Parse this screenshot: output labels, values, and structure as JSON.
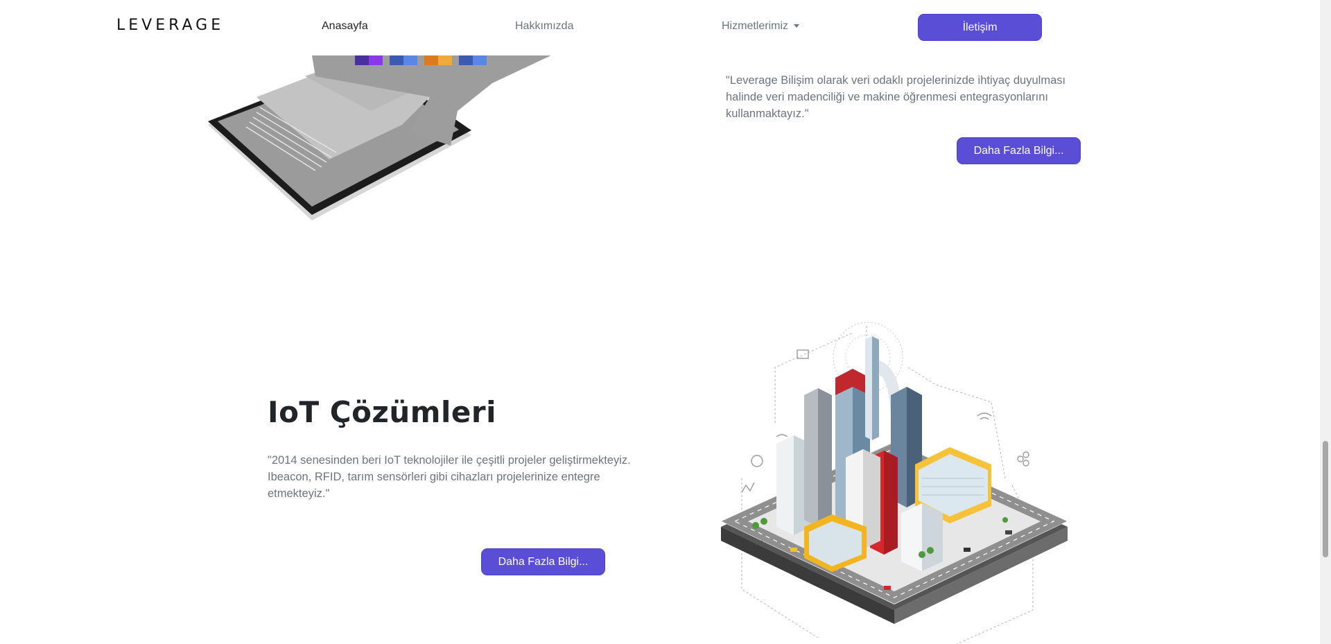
{
  "brand": {
    "name": "LEVERAGE"
  },
  "nav": {
    "home": "Anasayfa",
    "about": "Hakkımızda",
    "services": "Hizmetlerimiz",
    "contact": "İletişim"
  },
  "section_data": {
    "description": "\"Leverage Bilişim olarak veri odaklı projelerinizde ihtiyaç duyulması halinde veri madenciliği ve makine öğrenmesi entegrasyonlarını kullanmaktayız.\"",
    "button": "Daha Fazla Bilgi..."
  },
  "section_iot": {
    "title": "IoT Çözümleri",
    "description": "\"2014 senesinden beri IoT teknolojiler ile çeşitli projeler geliştirmekteyiz. Ibeacon, RFID, tarım sensörleri gibi cihazları projelerinize entegre etmekteyiz.\"",
    "button": "Daha Fazla Bilgi..."
  },
  "colors": {
    "accent": "#5b4ed6",
    "text_muted": "#6c757d",
    "text_dark": "#212529"
  }
}
